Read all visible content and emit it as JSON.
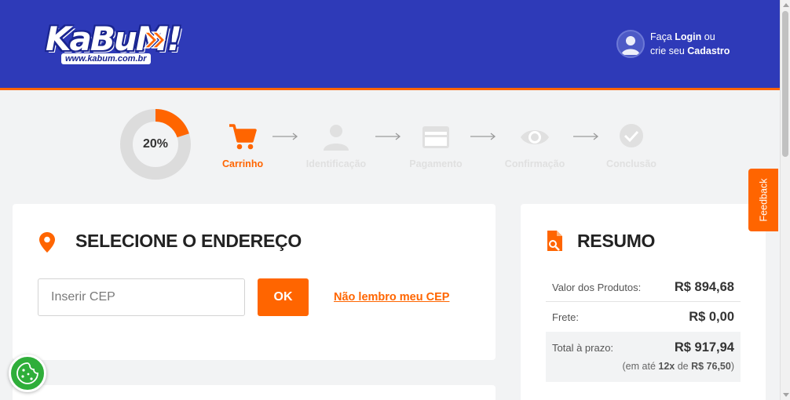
{
  "header": {
    "logo_text": "KaBuM!",
    "logo_url": "www.kabum.com.br",
    "login_prefix": "Faça ",
    "login_link": "Login",
    "login_mid": " ou",
    "signup_prefix": "crie seu ",
    "signup_link": "Cadastro"
  },
  "progress": {
    "percent_label": "20%",
    "percent_value": 0.2,
    "steps": [
      {
        "label": "Carrinho",
        "icon": "cart-icon",
        "active": true
      },
      {
        "label": "Identificação",
        "icon": "user-icon",
        "active": false
      },
      {
        "label": "Pagamento",
        "icon": "card-icon",
        "active": false
      },
      {
        "label": "Confirmação",
        "icon": "eye-icon",
        "active": false
      },
      {
        "label": "Conclusão",
        "icon": "check-icon",
        "active": false
      }
    ]
  },
  "address": {
    "title": "SELECIONE O ENDEREÇO",
    "cep_placeholder": "Inserir CEP",
    "ok_label": "OK",
    "forgot_cep_link": "Não lembro meu CEP"
  },
  "summary": {
    "title": "RESUMO",
    "products_label": "Valor dos Produtos:",
    "products_value": "R$ 894,68",
    "shipping_label": "Frete:",
    "shipping_value": "R$ 0,00",
    "total_label": "Total à prazo:",
    "total_value": "R$ 917,94",
    "installment_prefix": "(em até ",
    "installment_count": "12x",
    "installment_mid": " de ",
    "installment_value": "R$ 76,50",
    "installment_suffix": ")"
  },
  "feedback_label": "Feedback",
  "colors": {
    "brand_blue": "#2e3ab8",
    "accent_orange": "#ff6500",
    "inactive_gray": "#e0e0e0"
  }
}
